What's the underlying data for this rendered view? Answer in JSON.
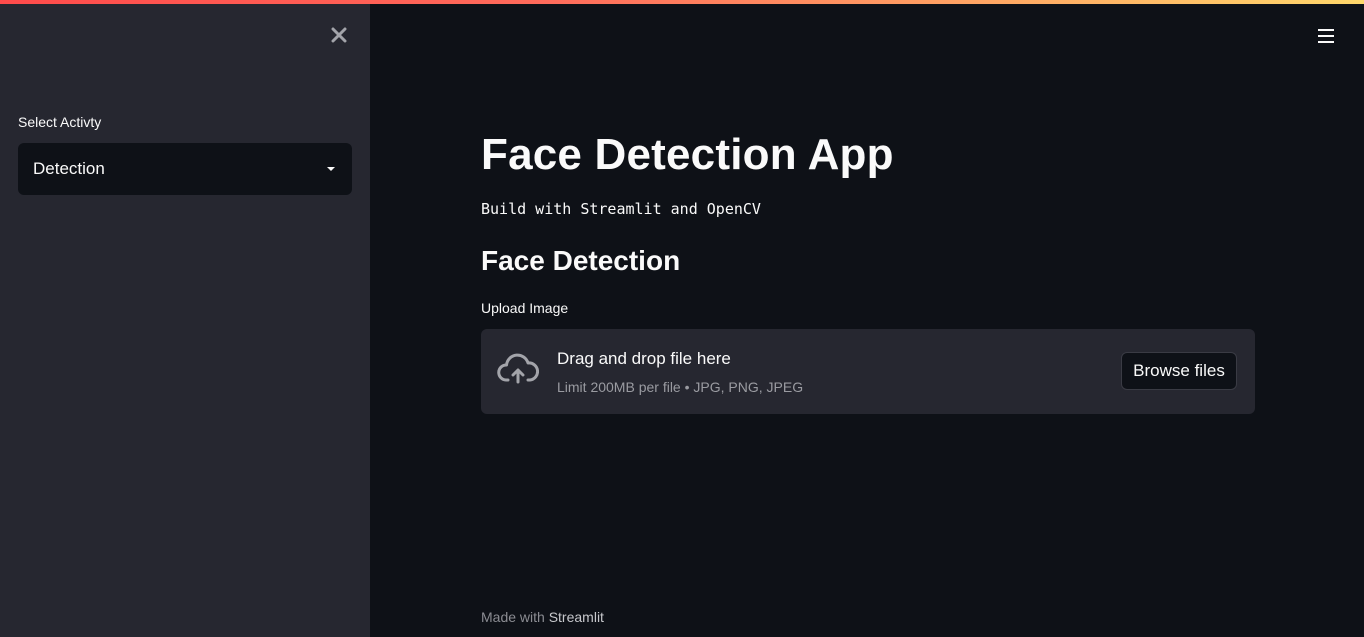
{
  "sidebar": {
    "close_icon": "close-icon",
    "select_label": "Select Activty",
    "select_value": "Detection"
  },
  "header": {
    "menu_icon": "hamburger-menu-icon"
  },
  "main": {
    "title": "Face Detection App",
    "subtitle": "Build with Streamlit and OpenCV",
    "section_title": "Face Detection",
    "uploader": {
      "label": "Upload Image",
      "icon": "cloud-upload-icon",
      "drop_title": "Drag and drop file here",
      "limit_text": "Limit 200MB per file • JPG, PNG, JPEG",
      "browse_label": "Browse files"
    }
  },
  "footer": {
    "prefix": "Made with ",
    "brand": "Streamlit"
  },
  "colors": {
    "background": "#0e1117",
    "sidebar": "#262730",
    "accent_start": "#ff4b4b",
    "accent_end": "#ffd86b"
  }
}
